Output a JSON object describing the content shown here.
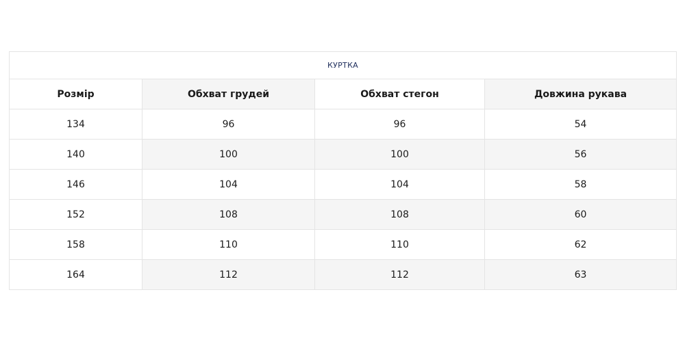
{
  "table": {
    "caption": "КУРТКА",
    "headers": [
      "Розмір",
      "Обхват грудей",
      "Обхват стегон",
      "Довжина рукава"
    ],
    "rows": [
      [
        "134",
        "96",
        "96",
        "54"
      ],
      [
        "140",
        "100",
        "100",
        "56"
      ],
      [
        "146",
        "104",
        "104",
        "58"
      ],
      [
        "152",
        "108",
        "108",
        "60"
      ],
      [
        "158",
        "110",
        "110",
        "62"
      ],
      [
        "164",
        "112",
        "112",
        "63"
      ]
    ]
  }
}
